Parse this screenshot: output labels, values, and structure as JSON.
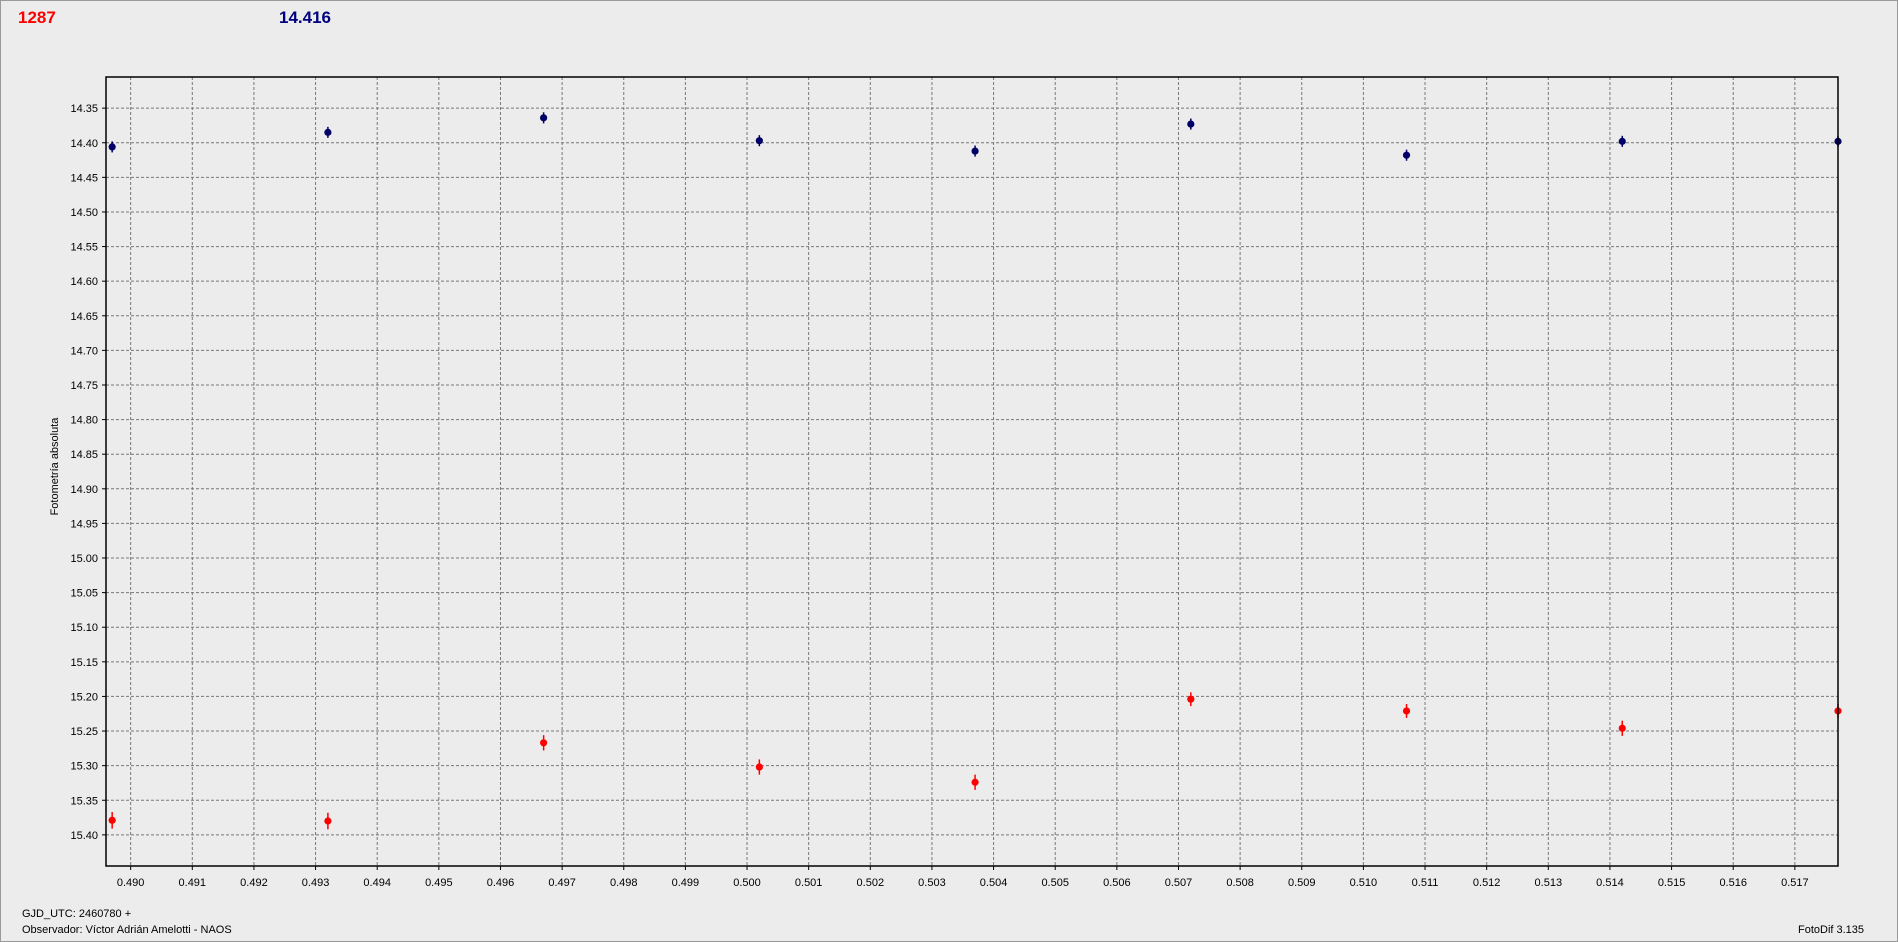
{
  "header": {
    "left_value": "1287",
    "right_value": "14.416"
  },
  "footer": {
    "gjd_label": "GJD_UTC: 2460780 +",
    "observer": "Observador: Víctor Adrián Amelotti - NAOS",
    "software": "FotoDif 3.135"
  },
  "chart_data": {
    "type": "scatter",
    "ylabel": "Fotometría absoluta",
    "xlabel": "",
    "xlim": [
      0.4896,
      0.5177
    ],
    "ylim": [
      14.305,
      15.445
    ],
    "y_inverted": true,
    "grid": true,
    "x_ticks": [
      "0.490",
      "0.491",
      "0.492",
      "0.493",
      "0.494",
      "0.495",
      "0.496",
      "0.497",
      "0.498",
      "0.499",
      "0.500",
      "0.501",
      "0.502",
      "0.503",
      "0.504",
      "0.505",
      "0.506",
      "0.507",
      "0.508",
      "0.509",
      "0.510",
      "0.511",
      "0.512",
      "0.513",
      "0.514",
      "0.515",
      "0.516",
      "0.517"
    ],
    "y_ticks": [
      "14.35",
      "14.40",
      "14.45",
      "14.50",
      "14.55",
      "14.60",
      "14.65",
      "14.70",
      "14.75",
      "14.80",
      "14.85",
      "14.90",
      "14.95",
      "15.00",
      "15.05",
      "15.10",
      "15.15",
      "15.20",
      "15.25",
      "15.30",
      "15.35",
      "15.40"
    ],
    "series": [
      {
        "color": "#ff0000",
        "x": [
          0.4897,
          0.4932,
          0.4967,
          0.5002,
          0.5037,
          0.5072,
          0.5107,
          0.5142,
          0.5177
        ],
        "y": [
          15.379,
          15.38,
          15.267,
          15.302,
          15.324,
          15.204,
          15.221,
          15.246,
          15.221
        ],
        "err": [
          0.012,
          0.012,
          0.011,
          0.011,
          0.011,
          0.01,
          0.01,
          0.011,
          0.01
        ]
      },
      {
        "color": "#000066",
        "x": [
          0.4897,
          0.4932,
          0.4967,
          0.5002,
          0.5037,
          0.5072,
          0.5107,
          0.5142,
          0.5177
        ],
        "y": [
          14.406,
          14.385,
          14.364,
          14.397,
          14.412,
          14.373,
          14.418,
          14.398,
          14.398
        ],
        "err": [
          0.008,
          0.008,
          0.008,
          0.008,
          0.008,
          0.008,
          0.008,
          0.008,
          0.008
        ]
      }
    ]
  }
}
